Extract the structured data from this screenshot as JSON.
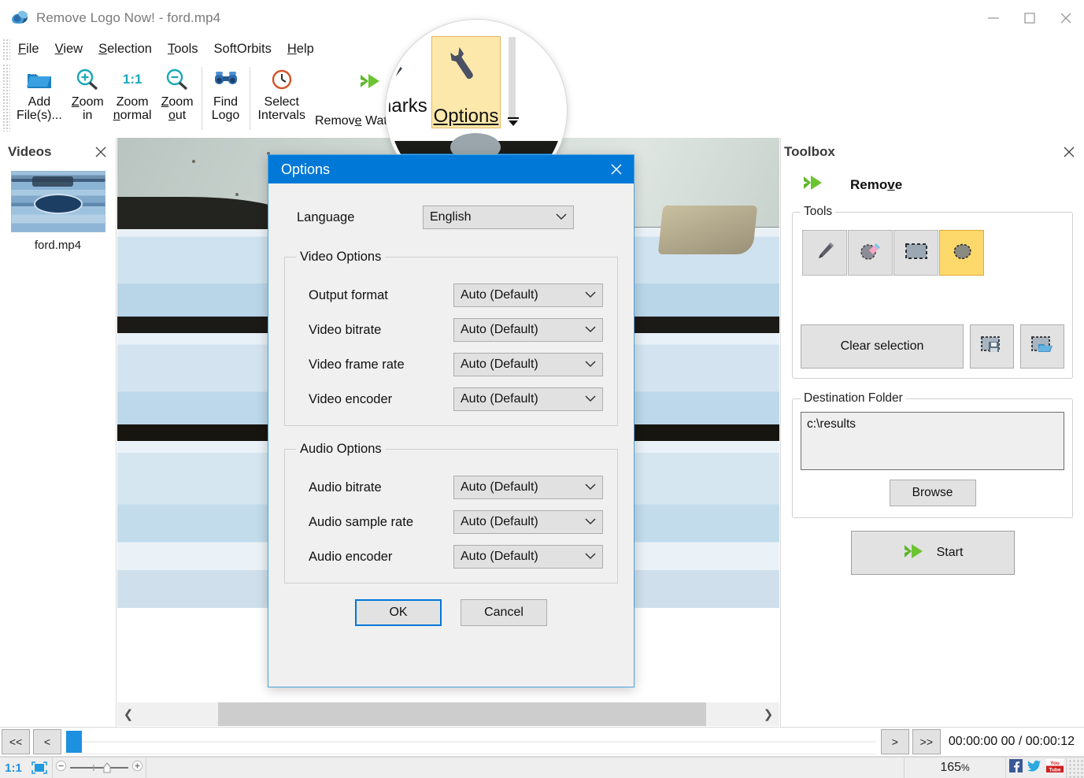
{
  "window": {
    "title": "Remove Logo Now! - ford.mp4",
    "app_icon": "softorbits-logo-icon",
    "controls": {
      "minimize": "minimize-icon",
      "maximize": "maximize-icon",
      "close": "close-icon"
    }
  },
  "menubar": {
    "items": [
      {
        "label": "File",
        "accel": "F"
      },
      {
        "label": "View",
        "accel": "V"
      },
      {
        "label": "Selection",
        "accel": "S"
      },
      {
        "label": "Tools",
        "accel": "T"
      },
      {
        "label": "SoftOrbits",
        "accel": ""
      },
      {
        "label": "Help",
        "accel": "H"
      }
    ]
  },
  "toolbar": {
    "buttons": [
      {
        "label_line1": "Add",
        "label_line2": "File(s)...",
        "icon": "open-folder-icon"
      },
      {
        "label_line1": "Zoom",
        "label_line2": "in",
        "icon": "zoom-in-icon"
      },
      {
        "label_line1": "Zoom",
        "label_line2": "normal",
        "icon": "one-to-one-icon"
      },
      {
        "label_line1": "Zoom",
        "label_line2": "out",
        "icon": "zoom-out-icon"
      },
      {
        "label_line1": "Find",
        "label_line2": "Logo",
        "icon": "binoculars-icon"
      },
      {
        "label_line1": "Select",
        "label_line2": "Intervals",
        "icon": "clock-icon"
      },
      {
        "label_line1": "Remove Watemarks",
        "label_line2": "",
        "icon": "green-double-arrow-icon"
      },
      {
        "label_line1": "Options",
        "label_line2": "",
        "icon": "wrench-icon"
      }
    ],
    "overflow": "overflow-chevron-icon"
  },
  "magnifier": {
    "option_button_label": "Options",
    "watermarks_label": "Remove Watemarks",
    "wrench_icon": "wrench-icon",
    "highlight_color": "#fde8ac",
    "border_color": "#e3b75e"
  },
  "videos_panel": {
    "title": "Videos",
    "close_icon": "close-icon",
    "items": [
      {
        "name": "ford.mp4",
        "thumbnail": "video-thumbnail"
      }
    ]
  },
  "canvas": {
    "scroll_left_icon": "chevron-left-icon",
    "scroll_right_icon": "chevron-right-icon"
  },
  "toolbox": {
    "title": "Toolbox",
    "close_icon": "close-icon",
    "mode_label": "Remove",
    "mode_icon": "green-double-arrow-icon",
    "tools_group_label": "Tools",
    "tools": [
      {
        "name": "pencil-tool",
        "icon": "pencil-icon",
        "selected": false
      },
      {
        "name": "stamp-tool",
        "icon": "eraser-stamp-icon",
        "selected": false
      },
      {
        "name": "rectangle-select-tool",
        "icon": "rectangle-select-icon",
        "selected": false
      },
      {
        "name": "lasso-select-tool",
        "icon": "lasso-icon",
        "selected": true
      }
    ],
    "clear_selection_label": "Clear selection",
    "save_selection_icon": "save-selection-icon",
    "load_selection_icon": "load-selection-icon",
    "destination_group_label": "Destination Folder",
    "destination_value": "c:\\results",
    "browse_label": "Browse",
    "start_label": "Start",
    "start_icon": "green-double-arrow-icon"
  },
  "dialog": {
    "title": "Options",
    "close_icon": "close-icon",
    "language_label": "Language",
    "language_value": "English",
    "video_group_label": "Video Options",
    "video_fields": [
      {
        "label": "Output format",
        "value": "Auto (Default)"
      },
      {
        "label": "Video bitrate",
        "value": "Auto (Default)"
      },
      {
        "label": "Video frame rate",
        "value": "Auto (Default)"
      },
      {
        "label": "Video encoder",
        "value": "Auto (Default)"
      }
    ],
    "audio_group_label": "Audio Options",
    "audio_fields": [
      {
        "label": "Audio bitrate",
        "value": "Auto (Default)"
      },
      {
        "label": "Audio sample rate",
        "value": "Auto (Default)"
      },
      {
        "label": "Audio encoder",
        "value": "Auto (Default)"
      }
    ],
    "ok_label": "OK",
    "cancel_label": "Cancel",
    "accent_color": "#0078d7"
  },
  "playbar": {
    "rewind_all_label": "<<",
    "rewind_label": "<",
    "forward_label": ">",
    "forward_all_label": ">>",
    "time_text": "00:00:00 00 / 00:00:12"
  },
  "statusbar": {
    "one_to_one_label": "1:1",
    "fit_icon": "fit-to-screen-icon",
    "zoom_minus_icon": "minus-icon",
    "zoom_plus_icon": "plus-icon",
    "zoom_value": "165",
    "zoom_unit": "%",
    "social": [
      {
        "name": "facebook-icon"
      },
      {
        "name": "twitter-icon"
      },
      {
        "name": "youtube-icon"
      }
    ]
  }
}
